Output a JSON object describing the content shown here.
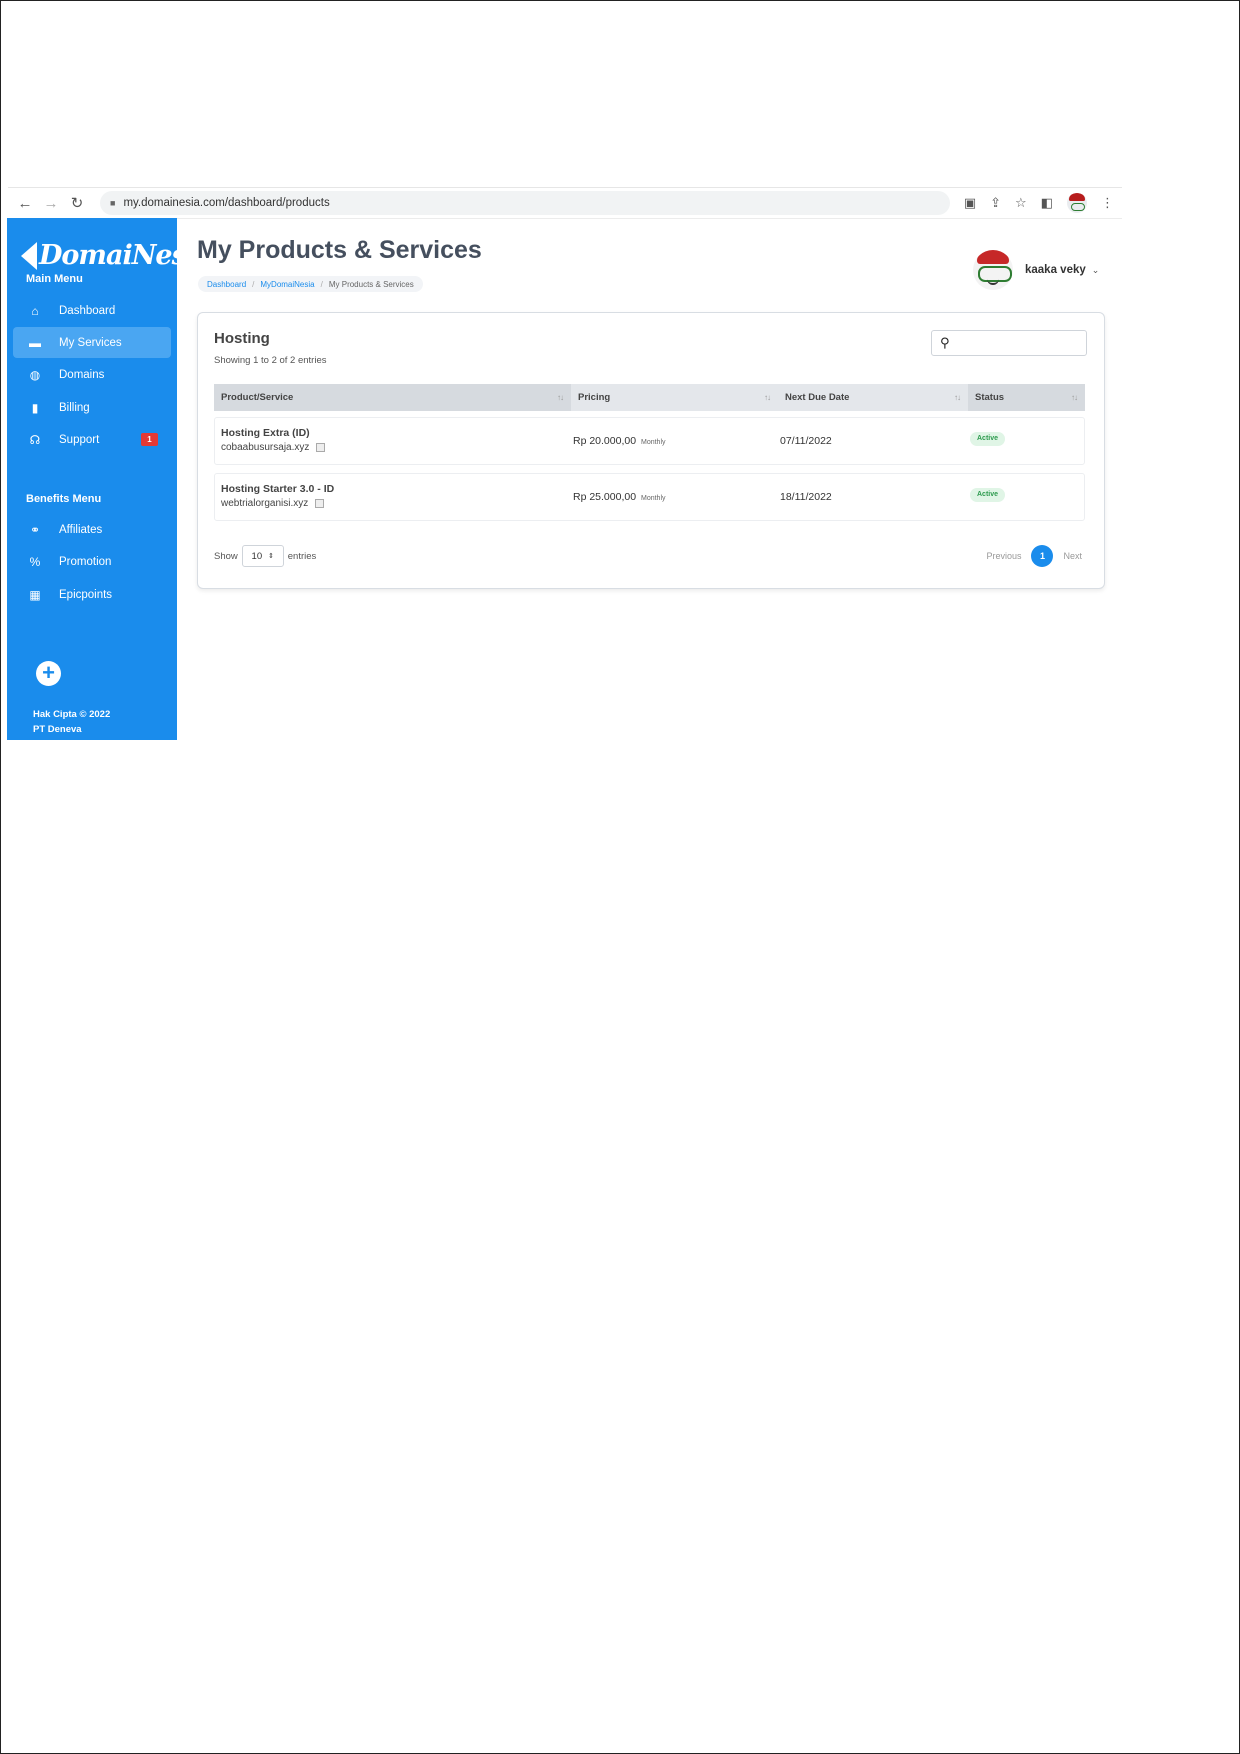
{
  "browser": {
    "url": "my.domainesia.com/dashboard/products",
    "back_glyph": "←",
    "forward_glyph": "→",
    "reload_glyph": "↻"
  },
  "sidebar": {
    "brand": "DomaiNesia",
    "main_menu_title": "Main Menu",
    "main_menu": [
      {
        "label": "Dashboard",
        "icon": "home-icon",
        "glyph": "⌂"
      },
      {
        "label": "My Services",
        "icon": "server-icon",
        "glyph": "▬"
      },
      {
        "label": "Domains",
        "icon": "globe-icon",
        "glyph": "◍"
      },
      {
        "label": "Billing",
        "icon": "invoice-icon",
        "glyph": "▮"
      },
      {
        "label": "Support",
        "icon": "headset-icon",
        "glyph": "☊",
        "badge": "1"
      }
    ],
    "benefits_menu_title": "Benefits Menu",
    "benefits_menu": [
      {
        "label": "Affiliates",
        "icon": "handshake-icon",
        "glyph": "⚭"
      },
      {
        "label": "Promotion",
        "icon": "percent-icon",
        "glyph": "%"
      },
      {
        "label": "Epicpoints",
        "icon": "gift-icon",
        "glyph": "▦"
      }
    ],
    "add_glyph": "+",
    "copyright_line1": "Hak Cipta © 2022",
    "copyright_line2": "PT Deneva"
  },
  "header": {
    "title": "My Products & Services",
    "breadcrumb": [
      "Dashboard",
      "MyDomaiNesia",
      "My Products & Services"
    ],
    "breadcrumb_sep": "/",
    "user_name": "kaaka veky"
  },
  "card": {
    "title": "Hosting",
    "showing": "Showing 1 to 2 of 2 entries",
    "search_placeholder": "",
    "columns": [
      "Product/Service",
      "Pricing",
      "Next Due Date",
      "Status"
    ],
    "rows": [
      {
        "name": "Hosting Extra (ID)",
        "domain": "cobaabusursaja.xyz",
        "price": "Rp 20.000,00",
        "cycle": "Monthly",
        "due": "07/11/2022",
        "status": "Active"
      },
      {
        "name": "Hosting Starter 3.0 - ID",
        "domain": "webtrialorganisi.xyz",
        "price": "Rp 25.000,00",
        "cycle": "Monthly",
        "due": "18/11/2022",
        "status": "Active"
      }
    ],
    "show_label": "Show",
    "entries_value": "10",
    "entries_label": "entries",
    "previous": "Previous",
    "current_page": "1",
    "next": "Next"
  },
  "colors": {
    "sidebar_bg": "#1a8cec",
    "active_item": "#4aa6f2",
    "status_active_bg": "#e0f5e6",
    "status_active_text": "#2e9b4f"
  }
}
